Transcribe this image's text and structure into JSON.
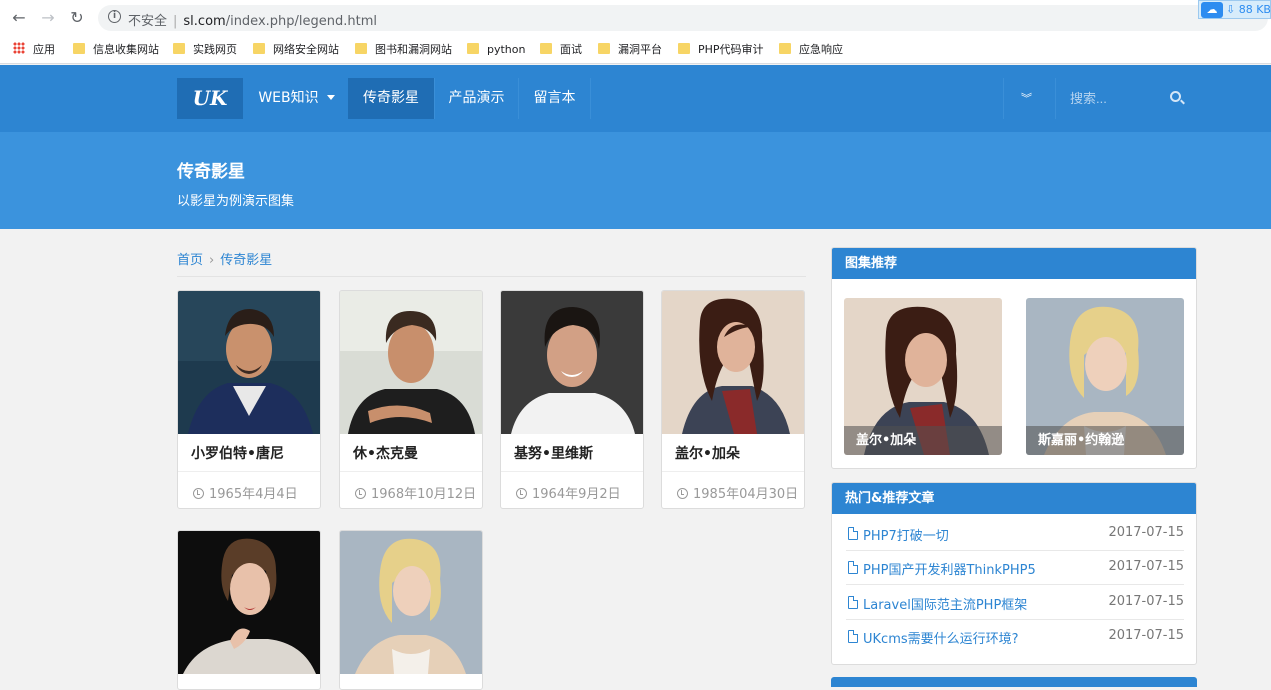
{
  "browser": {
    "insecure_label": "不安全",
    "url_host": "sl.com",
    "url_path": "/index.php/legend.html",
    "download_badge": "88 KB"
  },
  "bookmarks": [
    "应用",
    "信息收集网站",
    "实践网页",
    "网络安全网站",
    "图书和漏洞网站",
    "python",
    "面试",
    "漏洞平台",
    "PHP代码审计",
    "应急响应"
  ],
  "nav": {
    "logo": "UK",
    "items": [
      "WEB知识",
      "传奇影星",
      "产品演示",
      "留言本"
    ],
    "search_placeholder": "搜索..."
  },
  "banner": {
    "title": "传奇影星",
    "subtitle": "以影星为例演示图集"
  },
  "breadcrumb": {
    "home": "首页",
    "current": "传奇影星"
  },
  "cards": [
    {
      "name": "小罗伯特•唐尼",
      "date": "1965年4月4日"
    },
    {
      "name": "休•杰克曼",
      "date": "1968年10月12日"
    },
    {
      "name": "基努•里维斯",
      "date": "1964年9月2日"
    },
    {
      "name": "盖尔•加朵",
      "date": "1985年04月30日"
    }
  ],
  "sidebar": {
    "gallery_title": "图集推荐",
    "gallery": [
      {
        "caption": "盖尔•加朵"
      },
      {
        "caption": "斯嘉丽•约翰逊"
      }
    ],
    "articles_title": "热门&推荐文章",
    "articles": [
      {
        "title": "PHP7打破一切",
        "date": "2017-07-15"
      },
      {
        "title": "PHP国产开发利器ThinkPHP5",
        "date": "2017-07-15"
      },
      {
        "title": "Laravel国际范主流PHP框架",
        "date": "2017-07-15"
      },
      {
        "title": "UKcms需要什么运行环境?",
        "date": "2017-07-15"
      }
    ]
  }
}
